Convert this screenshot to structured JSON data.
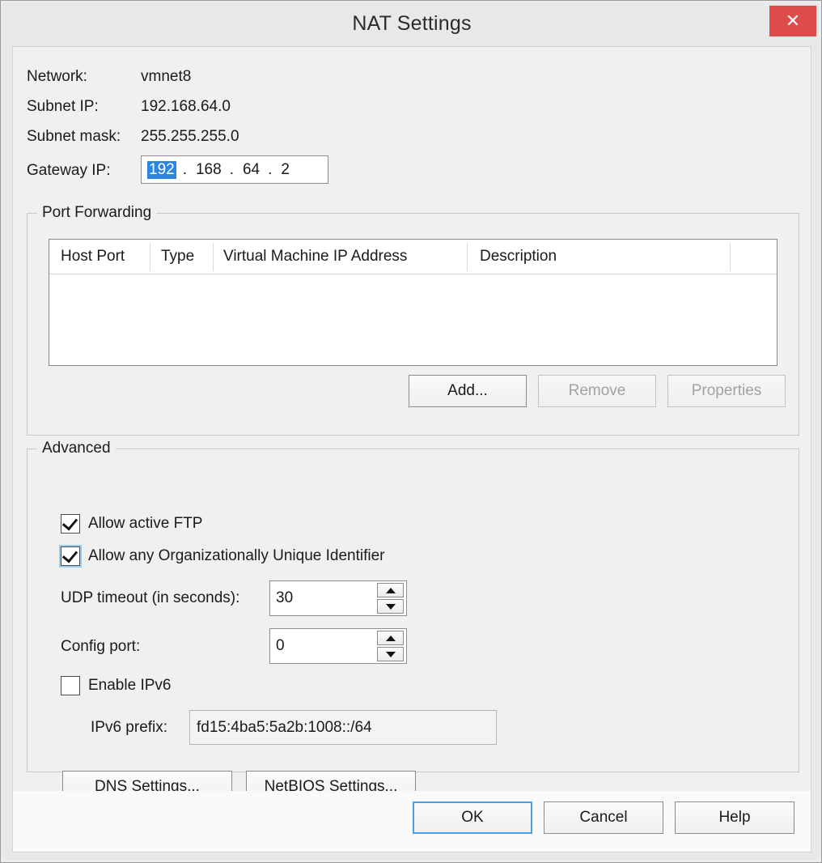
{
  "window": {
    "title": "NAT Settings",
    "close_icon": "close-icon",
    "close_glyph": "✕"
  },
  "info": {
    "network_label": "Network:",
    "network_value": "vmnet8",
    "subnet_ip_label": "Subnet IP:",
    "subnet_ip_value": "192.168.64.0",
    "subnet_mask_label": "Subnet mask:",
    "subnet_mask_value": "255.255.255.0",
    "gateway_label": "Gateway IP:"
  },
  "gateway_ip": {
    "octet1": "192",
    "octet2": "168",
    "octet3": "64",
    "octet4": "2",
    "separator": ".",
    "selected_octet": 1,
    "selection_color": "#2b86e0"
  },
  "port_forwarding": {
    "group_title": "Port Forwarding",
    "columns": [
      "Host Port",
      "Type",
      "Virtual Machine IP Address",
      "Description"
    ],
    "rows": [],
    "buttons": {
      "add": "Add...",
      "remove": "Remove",
      "properties": "Properties"
    },
    "add_enabled": true,
    "remove_enabled": false,
    "properties_enabled": false
  },
  "advanced": {
    "group_title": "Advanced",
    "allow_active_ftp": {
      "label": "Allow active FTP",
      "checked": true,
      "focused": false
    },
    "allow_any_oui": {
      "label": "Allow any Organizationally Unique Identifier",
      "checked": true,
      "focused": true
    },
    "udp_timeout": {
      "label": "UDP timeout (in seconds):",
      "value": "30"
    },
    "config_port": {
      "label": "Config port:",
      "value": "0"
    },
    "enable_ipv6": {
      "label": "Enable IPv6",
      "checked": false
    },
    "ipv6_prefix": {
      "label": "IPv6 prefix:",
      "value": "fd15:4ba5:5a2b:1008::/64"
    },
    "buttons": {
      "dns": "DNS Settings...",
      "netbios": "NetBIOS Settings..."
    }
  },
  "footer": {
    "ok": "OK",
    "cancel": "Cancel",
    "help": "Help",
    "default_button": "OK",
    "focus_color": "#4a9de0"
  }
}
